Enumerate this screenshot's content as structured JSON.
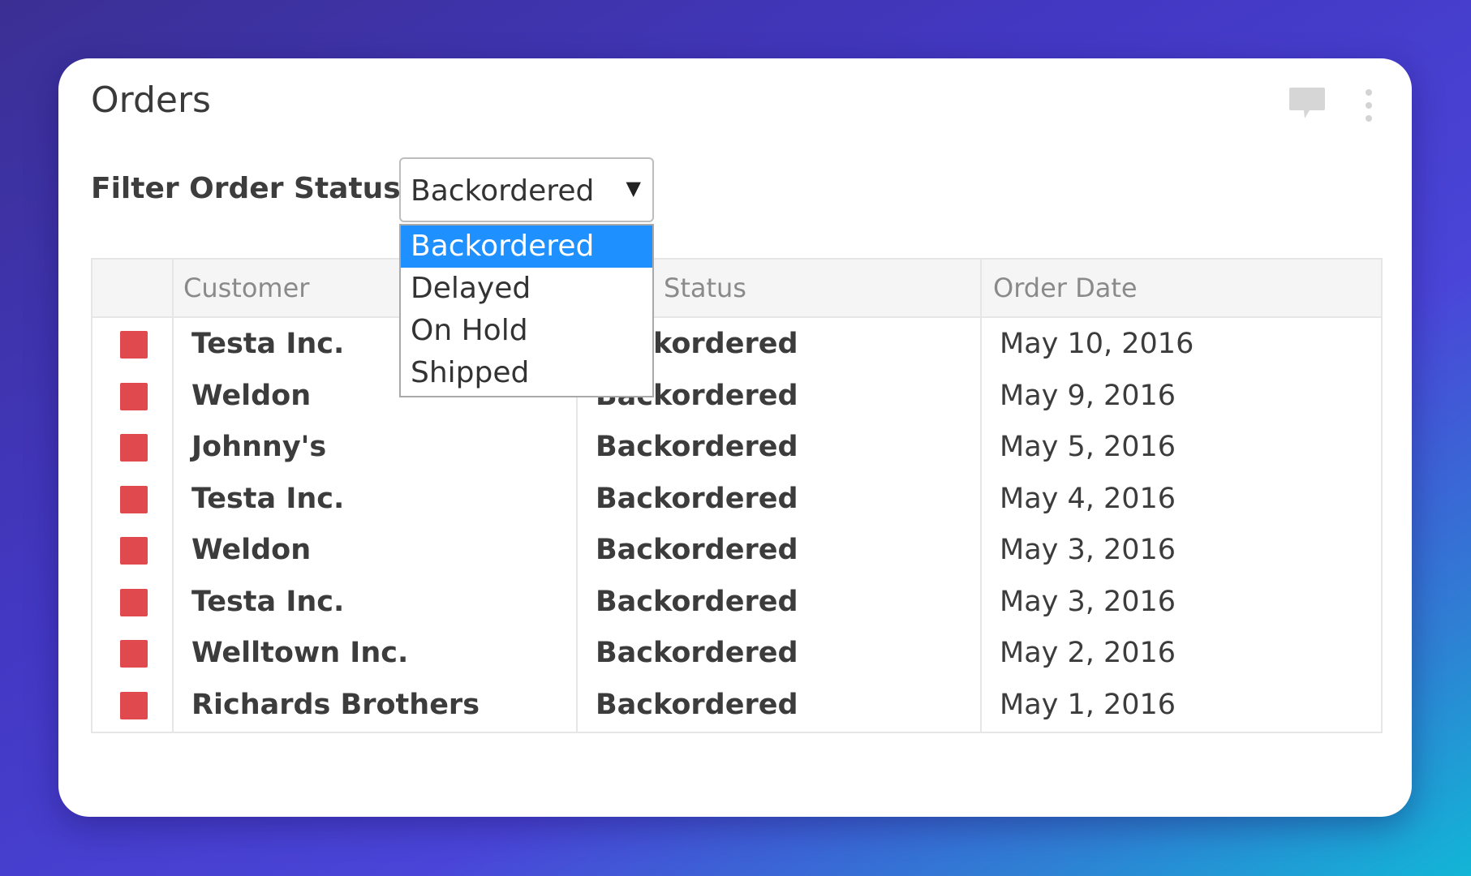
{
  "card": {
    "title": "Orders"
  },
  "icons": {
    "comment": "comment-icon",
    "more": "more-vertical-icon"
  },
  "filter": {
    "label": "Filter Order Status:",
    "selected": "Backordered",
    "arrow": "▼",
    "options": [
      "Backordered",
      "Delayed",
      "On Hold",
      "Shipped"
    ]
  },
  "table": {
    "columns": [
      "",
      "Customer",
      "Status",
      "Order Date"
    ],
    "status_color": "#e04a4f",
    "rows": [
      {
        "customer": "Testa Inc.",
        "status": "Backordered",
        "date": "May 10, 2016"
      },
      {
        "customer": "Weldon",
        "status": "Backordered",
        "date": "May 9, 2016"
      },
      {
        "customer": "Johnny's",
        "status": "Backordered",
        "date": "May 5, 2016"
      },
      {
        "customer": "Testa Inc.",
        "status": "Backordered",
        "date": "May 4, 2016"
      },
      {
        "customer": "Weldon",
        "status": "Backordered",
        "date": "May 3, 2016"
      },
      {
        "customer": "Testa Inc.",
        "status": "Backordered",
        "date": "May 3, 2016"
      },
      {
        "customer": "Welltown Inc.",
        "status": "Backordered",
        "date": "May 2, 2016"
      },
      {
        "customer": "Richards Brothers",
        "status": "Backordered",
        "date": "May 1, 2016"
      }
    ]
  },
  "colors": {
    "dropdown_highlight": "#1e90ff",
    "background_start": "#3b2f94",
    "background_end": "#12b6d6"
  }
}
